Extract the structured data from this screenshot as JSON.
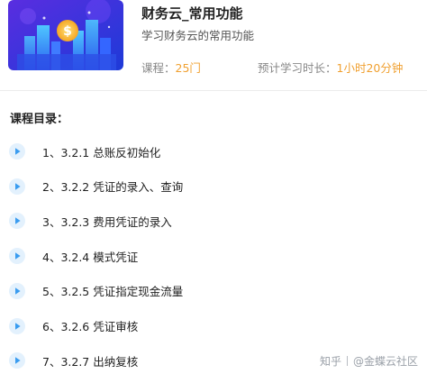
{
  "course": {
    "title": "财务云_常用功能",
    "subtitle": "学习财务云的常用功能",
    "lessons_label": "课程：",
    "lessons_value": "25门",
    "duration_label": "预计学习时长：",
    "duration_value": "1小时20分钟",
    "accent_color": "#f0a030"
  },
  "catalog": {
    "title": "课程目录：",
    "items": [
      {
        "label": "1、3.2.1 总账反初始化"
      },
      {
        "label": "2、3.2.2 凭证的录入、查询"
      },
      {
        "label": "3、3.2.3 费用凭证的录入"
      },
      {
        "label": "4、3.2.4 模式凭证"
      },
      {
        "label": "5、3.2.5 凭证指定现金流量"
      },
      {
        "label": "6、3.2.6 凭证审核"
      },
      {
        "label": "7、3.2.7 出纳复核"
      }
    ],
    "icon": "play-icon",
    "icon_color": "#3a9cf0"
  },
  "watermark": {
    "left": "知乎",
    "right": "@金蝶云社区"
  }
}
